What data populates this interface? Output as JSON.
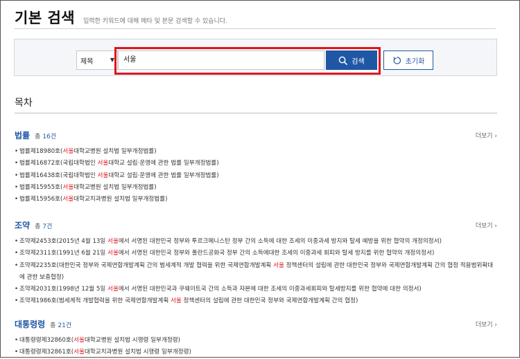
{
  "header": {
    "title": "기본 검색",
    "description": "입력한 키워드에 대해 메타 및 본문 검색할 수 있습니다."
  },
  "search": {
    "select_value": "제목",
    "input_value": "서울",
    "search_label": "검색",
    "reset_label": "초기화"
  },
  "toc": {
    "title": "목차"
  },
  "sections": [
    {
      "title": "법률",
      "count_label": "총",
      "count": "16건",
      "more": "더보기",
      "items": [
        {
          "pre": "법률제18980호(",
          "hl": "서울",
          "post": "대학교병원 설치법 일부개정법률)"
        },
        {
          "pre": "법률제16872호(국립대학법인 ",
          "hl": "서울",
          "post": "대학교 설립·운영에 관한 법률 일부개정법률)"
        },
        {
          "pre": "법률제16438호(국립대학법인 ",
          "hl": "서울",
          "post": "대학교 설립·운영에 관한 법률 일부개정법률)"
        },
        {
          "pre": "법률제15955호(",
          "hl": "서울",
          "post": "대학교병원 설치법 일부개정법률)"
        },
        {
          "pre": "법률제15956호(",
          "hl": "서울",
          "post": "대학교치과병원 설치법 일부개정법률)"
        }
      ]
    },
    {
      "title": "조약",
      "count_label": "총",
      "count": "7건",
      "more": "더보기",
      "items": [
        {
          "pre": "조약제2453호(2015년 4월 13일 ",
          "hl": "서울",
          "post": "에서 서명된 대한민국 정부와 투르크메니스탄 정부 간의 소득에 대한 조세의 이중과세 방지와 탈세 예방을 위한 협약의 개정의정서)"
        },
        {
          "pre": "조약제2311호(1991년 6월 21일 ",
          "hl": "서울",
          "post": "에서 서명된 대한민국 정부와 폴란드공화국 정부 간의 소득에대한 조세의 이중과세 회피와 탈세 방지를 위한 협약의 개정의정서)"
        },
        {
          "pre": "조약제2235호(대한민국 정부와 국제연합개발계획 간의 범세계적 개발 협력을 위한 국제연합개발계획 ",
          "hl": "서울",
          "post": " 정책센터의 설립에 관한 대한민국 정부와 국제연합개발계획 간의 협정 적용범위확대에 관한 보충협정)"
        },
        {
          "pre": "조약제2031호(1998년 12월 5일 ",
          "hl": "서울",
          "post": "에서 서명된 대한민국과 쿠웨이트국 간의 소득과 자본에 대한 조세의 이중과세회피와 탈세방지를 위한 협약에 대한 의정서)"
        },
        {
          "pre": "조약제1986호(범세계적 개발협력을 위한 국제연합개발계획 ",
          "hl": "서울",
          "post": " 정책센터의 설립에 관한 대한민국 정부와 국제연합개발계획 간의 협정)"
        }
      ]
    },
    {
      "title": "대통령령",
      "count_label": "총",
      "count": "21건",
      "more": "더보기",
      "items": [
        {
          "pre": "대통령령제32860호(",
          "hl": "서울",
          "post": "대학교병원 설치법 시행령 일부개정령)"
        },
        {
          "pre": "대통령령제32861호(",
          "hl": "서울",
          "post": "대학교치과병원 설치법 시행령 일부개정령)"
        }
      ]
    }
  ]
}
